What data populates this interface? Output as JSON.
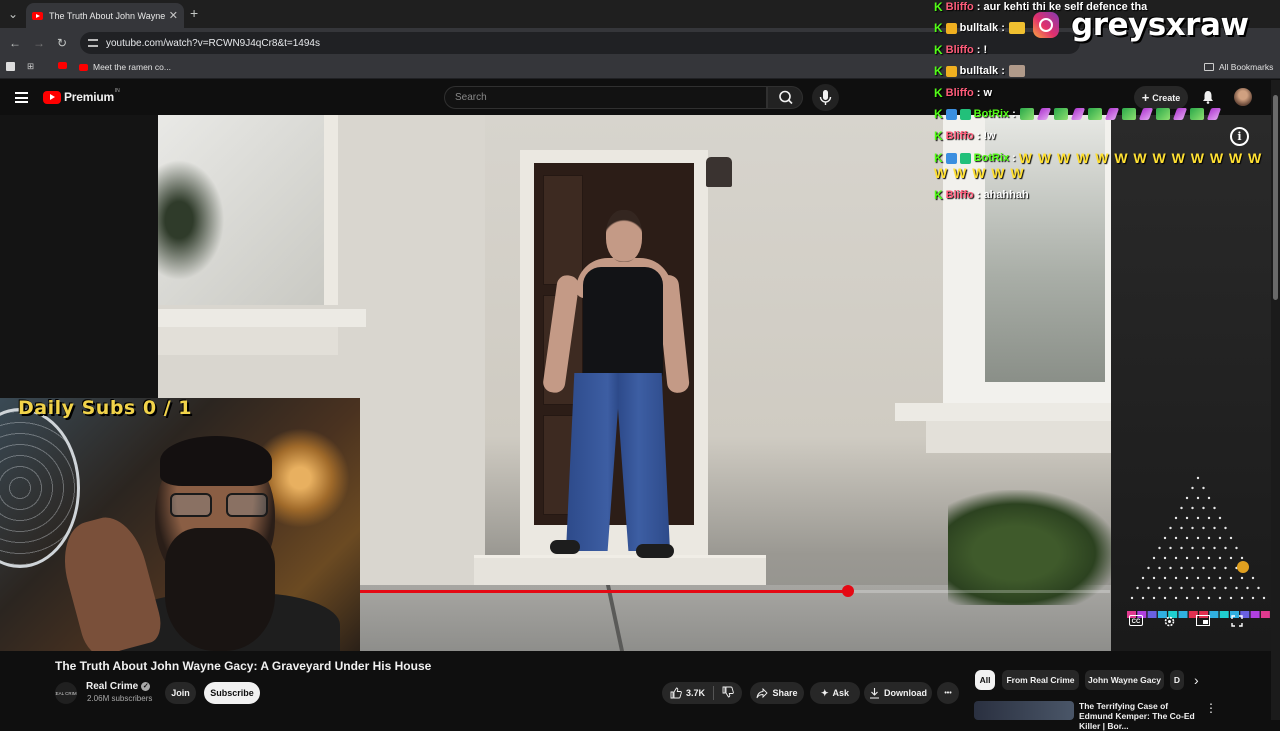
{
  "browser": {
    "tab_title": "The Truth About John Wayne G",
    "tab_close": "✕",
    "new_tab": "+",
    "url": "youtube.com/watch?v=RCWN9J4qCr8&t=1494s",
    "bookmark_1": "Meet the ramen co...",
    "all_bookmarks": "All Bookmarks"
  },
  "youtube": {
    "logo_text": "Premium",
    "logo_region": "IN",
    "search_placeholder": "Search",
    "create_label": "Create"
  },
  "video": {
    "progress_fraction": 0.645
  },
  "webcam": {
    "daily_subs": "Daily Subs  0 / 1"
  },
  "overlay": {
    "instagram_handle": "greysxraw"
  },
  "chat": [
    {
      "name": "Bliffo",
      "sep": ":",
      "msg": "aur kehti thi ke self defence tha",
      "color": "#ff5c7a"
    },
    {
      "name": "bulltalk",
      "sep": ":",
      "msg": "",
      "color": "#ffffff"
    },
    {
      "name": "Bliffo",
      "sep": ":",
      "msg": "!",
      "color": "#ff5c7a"
    },
    {
      "name": "bulltalk",
      "sep": ":",
      "msg": "",
      "color": "#ffffff"
    },
    {
      "name": "Bliffo",
      "sep": ":",
      "msg": "w",
      "color": "#ff5c7a"
    },
    {
      "name": "BotRix",
      "sep": ":",
      "msg": "",
      "color": "#53fc18"
    },
    {
      "name": "Bliffo",
      "sep": ":",
      "msg": "!w",
      "color": "#ff5c7a"
    },
    {
      "name": "BotRix",
      "sep": ":",
      "msg": "W W W W W W W W W W W W W",
      "msg2": "W W W W W",
      "color": "#53fc18"
    },
    {
      "name": "Bliffo",
      "sep": ":",
      "msg": "ahahhah",
      "color": "#ff5c7a"
    }
  ],
  "details": {
    "title": "The Truth About John Wayne Gacy: A Graveyard Under His House",
    "channel": "Real Crime",
    "subscribers": "2.06M subscribers",
    "join": "Join",
    "subscribe": "Subscribe",
    "likes": "3.7K",
    "share": "Share",
    "ask": "Ask",
    "download": "Download",
    "more": "•••"
  },
  "sidebar": {
    "chips": [
      "All",
      "From Real Crime",
      "John Wayne Gacy",
      "D"
    ],
    "rec_title": "The Terrifying Case of Edmund Kemper: The Co-Ed Killer | Bor..."
  },
  "colors": {
    "youtube_red": "#ff0000",
    "progress_red": "#e50914",
    "kick_green": "#53fc18",
    "subs_yellow": "#f1d34a"
  }
}
